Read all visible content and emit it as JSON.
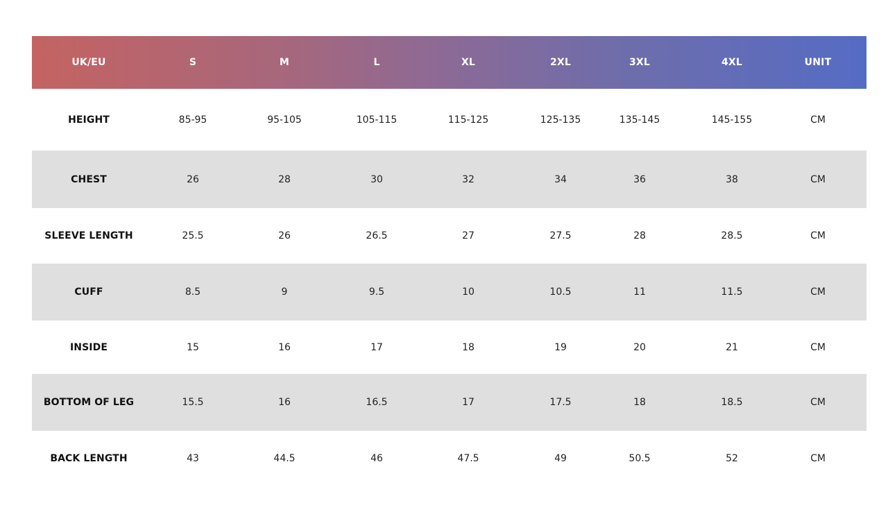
{
  "colors": {
    "header_gradient_start": "#c46362",
    "header_gradient_end": "#556cc4",
    "shaded_row": "#dfdfdf",
    "header_text": "#ffffff"
  },
  "header": [
    "UK/EU",
    "S",
    "M",
    "L",
    "XL",
    "2XL",
    "3XL",
    "4XL",
    "UNIT"
  ],
  "rows": [
    {
      "label": "HEIGHT",
      "values": [
        "85-95",
        "95-105",
        "105-115",
        "115-125",
        "125-135",
        "135-145",
        "145-155"
      ],
      "unit": "CM"
    },
    {
      "label": "CHEST",
      "values": [
        "26",
        "28",
        "30",
        "32",
        "34",
        "36",
        "38"
      ],
      "unit": "CM"
    },
    {
      "label": "SLEEVE LENGTH",
      "values": [
        "25.5",
        "26",
        "26.5",
        "27",
        "27.5",
        "28",
        "28.5"
      ],
      "unit": "CM"
    },
    {
      "label": "CUFF",
      "values": [
        "8.5",
        "9",
        "9.5",
        "10",
        "10.5",
        "11",
        "11.5"
      ],
      "unit": "CM"
    },
    {
      "label": "INSIDE",
      "values": [
        "15",
        "16",
        "17",
        "18",
        "19",
        "20",
        "21"
      ],
      "unit": "CM"
    },
    {
      "label": "BOTTOM OF LEG",
      "values": [
        "15.5",
        "16",
        "16.5",
        "17",
        "17.5",
        "18",
        "18.5"
      ],
      "unit": "CM"
    },
    {
      "label": "BACK LENGTH",
      "values": [
        "43",
        "44.5",
        "46",
        "47.5",
        "49",
        "50.5",
        "52"
      ],
      "unit": "CM"
    }
  ]
}
